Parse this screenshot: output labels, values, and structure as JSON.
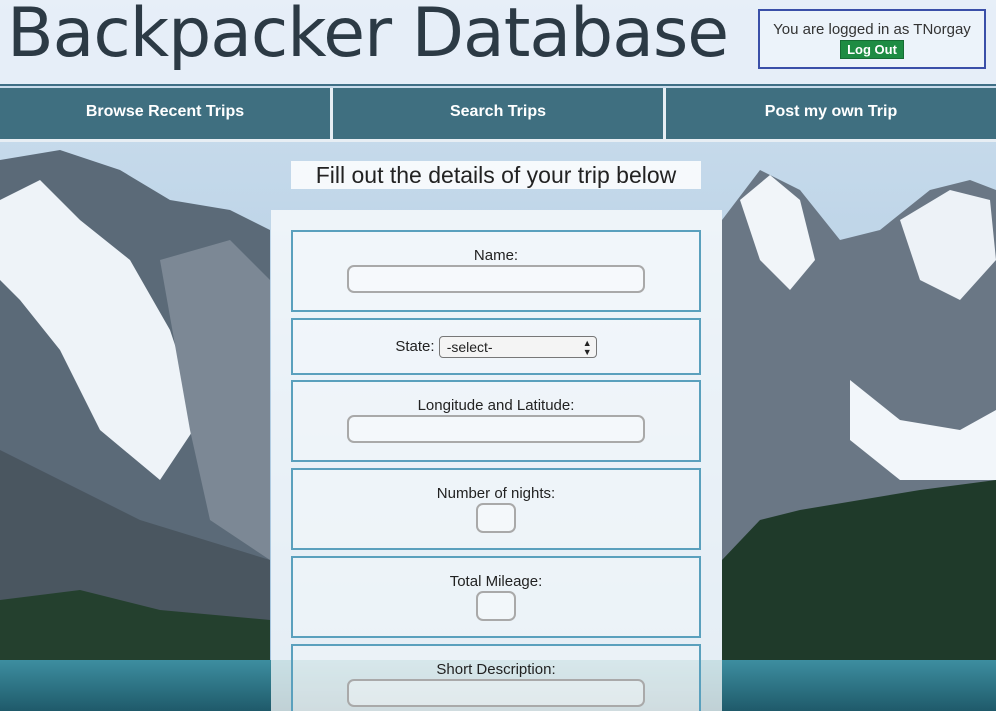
{
  "header": {
    "title": "Backpacker Database",
    "login_text": "You are logged in as TNorgay",
    "logout_label": "Log Out"
  },
  "nav": {
    "items": [
      {
        "label": "Browse Recent Trips"
      },
      {
        "label": "Search Trips"
      },
      {
        "label": "Post my own Trip"
      }
    ]
  },
  "form": {
    "heading": "Fill out the details of your trip below",
    "name_label": "Name:",
    "state_label": "State:",
    "state_selected": "-select-",
    "coords_label": "Longitude and Latitude:",
    "nights_label": "Number of nights:",
    "mileage_label": "Total Mileage:",
    "description_label": "Short Description:"
  },
  "colors": {
    "nav_bg": "#3f6f80",
    "logout_bg": "#1e8c43",
    "field_border": "#5aa0bd",
    "login_border": "#3a4fa8"
  }
}
